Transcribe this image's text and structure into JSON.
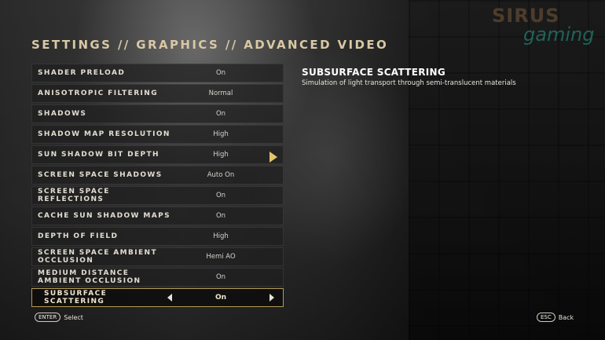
{
  "header": {
    "title": "SETTINGS // GRAPHICS // ADVANCED VIDEO"
  },
  "watermark": {
    "line1": "SIRUS",
    "line2": "gaming"
  },
  "settings": [
    {
      "label": "SHADER PRELOAD",
      "value": "On"
    },
    {
      "label": "ANISOTROPIC FILTERING",
      "value": "Normal"
    },
    {
      "label": "SHADOWS",
      "value": "On"
    },
    {
      "label": "SHADOW MAP RESOLUTION",
      "value": "High"
    },
    {
      "label": "SUN SHADOW BIT DEPTH",
      "value": "High"
    },
    {
      "label": "SCREEN SPACE SHADOWS",
      "value": "Auto On"
    },
    {
      "label": "SCREEN SPACE REFLECTIONS",
      "value": "On"
    },
    {
      "label": "CACHE SUN SHADOW MAPS",
      "value": "On"
    },
    {
      "label": "DEPTH OF FIELD",
      "value": "High"
    },
    {
      "label": "SCREEN SPACE AMBIENT OCCLUSION",
      "value": "Hemi AO"
    },
    {
      "label": "MEDIUM DISTANCE AMBIENT OCCLUSION",
      "value": "On"
    },
    {
      "label": "SUBSURFACE SCATTERING",
      "value": "On",
      "selected": true
    }
  ],
  "description": {
    "title": "SUBSURFACE SCATTERING",
    "text": "Simulation of light transport through semi-translucent materials"
  },
  "footer": {
    "select_key": "ENTER",
    "select_label": "Select",
    "back_key": "ESC",
    "back_label": "Back"
  },
  "colors": {
    "accent": "#b39a55",
    "title": "#d8c8a4",
    "cursor": "#e2c46a"
  }
}
